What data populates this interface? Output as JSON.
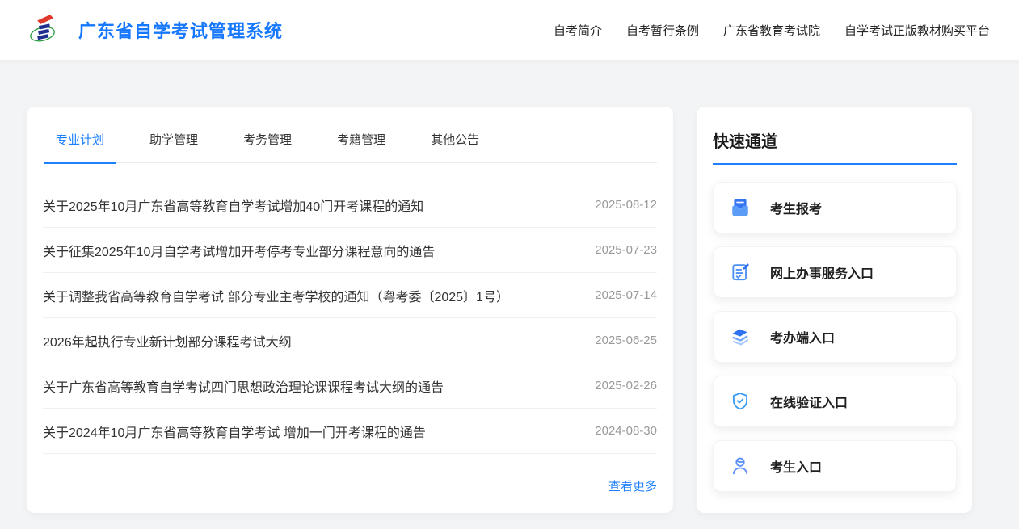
{
  "header": {
    "title": "广东省自学考试管理系统",
    "logo": "gdzk-logo",
    "nav": [
      {
        "label": "自考简介"
      },
      {
        "label": "自考暂行条例"
      },
      {
        "label": "广东省教育考试院"
      },
      {
        "label": "自学考试正版教材购买平台"
      }
    ]
  },
  "main": {
    "tabs": [
      {
        "label": "专业计划",
        "active": true
      },
      {
        "label": "助学管理",
        "active": false
      },
      {
        "label": "考务管理",
        "active": false
      },
      {
        "label": "考籍管理",
        "active": false
      },
      {
        "label": "其他公告",
        "active": false
      }
    ],
    "announcements": [
      {
        "title": "关于2025年10月广东省高等教育自学考试增加40门开考课程的通知",
        "date": "2025-08-12"
      },
      {
        "title": "关于征集2025年10月自学考试增加开考停考专业部分课程意向的通告",
        "date": "2025-07-23"
      },
      {
        "title": "关于调整我省高等教育自学考试 部分专业主考学校的通知（粤考委〔2025〕1号）",
        "date": "2025-07-14"
      },
      {
        "title": "2026年起执行专业新计划部分课程考试大纲",
        "date": "2025-06-25"
      },
      {
        "title": "关于广东省高等教育自学考试四门思想政治理论课课程考试大纲的通告",
        "date": "2025-02-26"
      },
      {
        "title": "关于2024年10月广东省高等教育自学考试 增加一门开考课程的通告",
        "date": "2024-08-30"
      }
    ],
    "more_label": "查看更多"
  },
  "sidebar": {
    "title": "快速通道",
    "links": [
      {
        "label": "考生报考",
        "icon": "inbox-icon"
      },
      {
        "label": "网上办事服务入口",
        "icon": "edit-document-icon"
      },
      {
        "label": "考办端入口",
        "icon": "layers-icon"
      },
      {
        "label": "在线验证入口",
        "icon": "shield-check-icon"
      },
      {
        "label": "考生入口",
        "icon": "user-icon"
      }
    ]
  },
  "colors": {
    "accent": "#1e80ff",
    "brand_title": "#1677ff",
    "text_primary": "#333333",
    "text_date": "#999999",
    "page_background": "#f3f4f5"
  }
}
